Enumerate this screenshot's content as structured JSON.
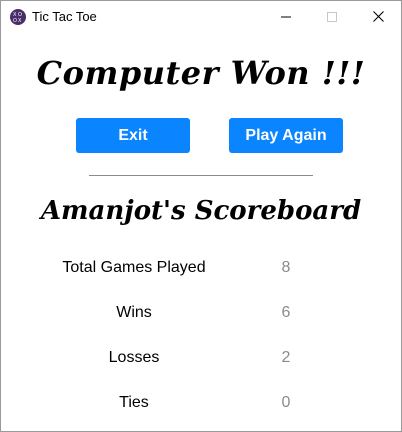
{
  "window": {
    "title": "Tic Tac Toe",
    "icon": "tic-tac-toe-app-icon"
  },
  "result": {
    "message": "Computer Won !!!"
  },
  "actions": {
    "exit_label": "Exit",
    "play_again_label": "Play Again"
  },
  "scoreboard": {
    "title": "Amanjot's Scoreboard",
    "rows": [
      {
        "label": "Total Games Played",
        "value": "8"
      },
      {
        "label": "Wins",
        "value": "6"
      },
      {
        "label": "Losses",
        "value": "2"
      },
      {
        "label": "Ties",
        "value": "0"
      }
    ]
  },
  "colors": {
    "button": "#0a84ff",
    "value_text": "#8a8a8a"
  }
}
